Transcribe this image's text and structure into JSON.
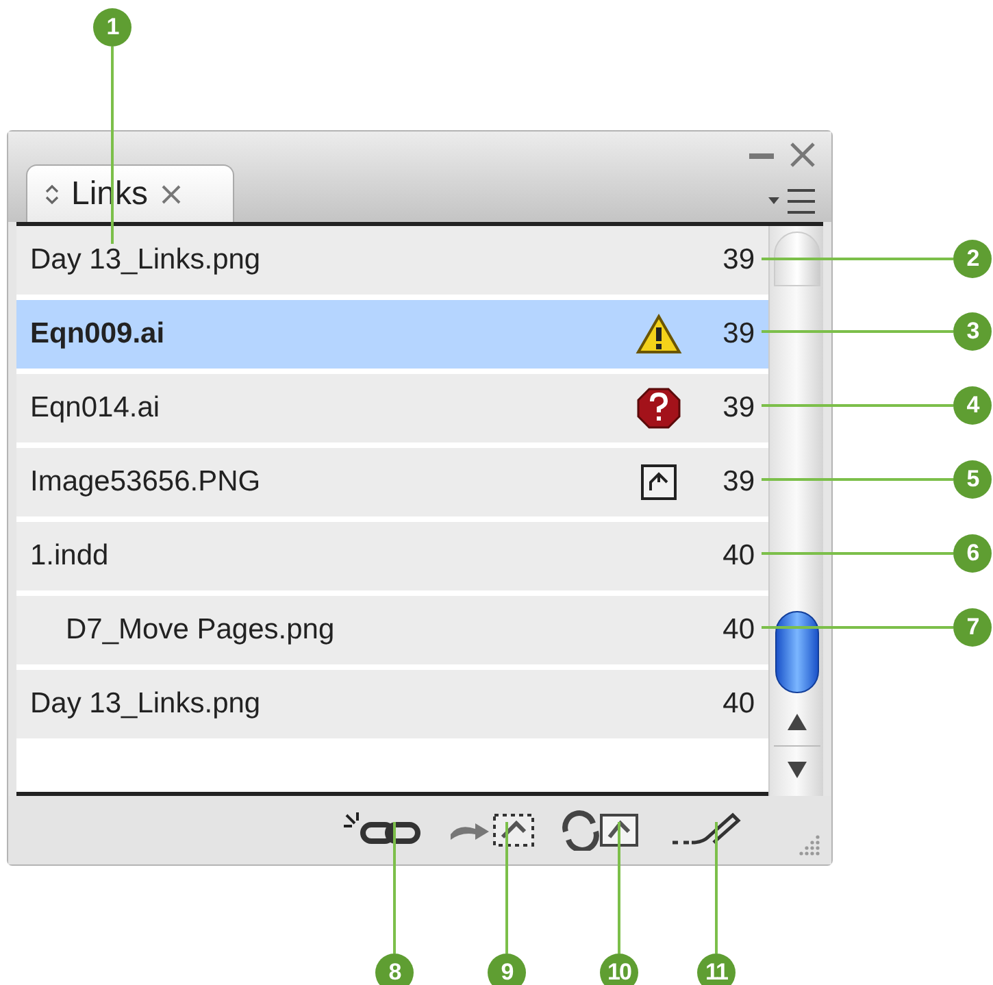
{
  "panel": {
    "tab": {
      "label": "Links",
      "selected": true
    },
    "links": [
      {
        "name": "Day 13_Links.png",
        "page": "39",
        "selected": false
      },
      {
        "name": "Eqn009.ai",
        "page": "39",
        "kind": "modified",
        "selected": true
      },
      {
        "name": "Eqn014.ai",
        "page": "39",
        "kind": "missing",
        "selected": false
      },
      {
        "name": "Image53656.PNG",
        "page": "39",
        "kind": "embedded",
        "selected": false
      },
      {
        "name": "1.indd",
        "page": "40",
        "selected": false,
        "children": [
          {
            "name": "D7_Move Pages.png",
            "page": "40",
            "selected": false
          }
        ]
      },
      {
        "name": "Day 13_Links.png",
        "page": "40",
        "selected": false
      }
    ]
  },
  "callouts": [
    "1",
    "2",
    "3",
    "4",
    "5",
    "6",
    "7",
    "8",
    "9",
    "10",
    "11"
  ]
}
